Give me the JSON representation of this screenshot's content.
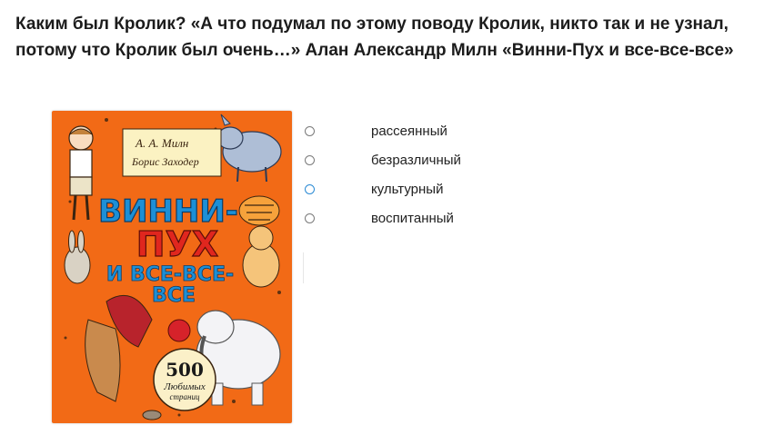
{
  "question": {
    "text": "Каким был Кролик? «А что подумал по этому поводу Кролик, никто так и не узнал, потому что Кролик был очень…» Алан Александр Милн «Винни-Пух и все-все-все»"
  },
  "book_cover": {
    "authors": [
      "А. А. Милн",
      "Борис Заходер"
    ],
    "title_lines": [
      "ВИННИ-",
      "ПУХ",
      "И ВСЕ-ВСЕ-",
      "ВСЕ"
    ],
    "badge_number": "500",
    "badge_text_lines": [
      "Любимых",
      "страниц"
    ],
    "background_color": "#f26a16"
  },
  "options": [
    {
      "label": "рассеянный",
      "state": "default"
    },
    {
      "label": "безразличный",
      "state": "default"
    },
    {
      "label": "культурный",
      "state": "hover"
    },
    {
      "label": "воспитанный",
      "state": "default"
    }
  ],
  "colors": {
    "radio_border": "#7a7a7a",
    "radio_hover": "#2a8ad4"
  }
}
